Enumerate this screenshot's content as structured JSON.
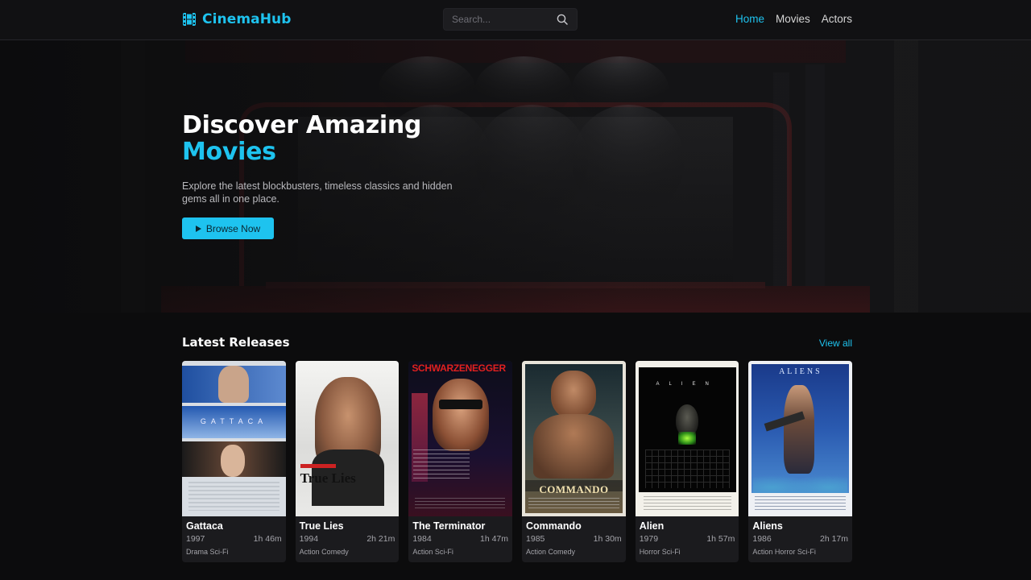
{
  "navbar": {
    "brand": "CinemaHub",
    "search_placeholder": "Search...",
    "links": [
      {
        "label": "Home",
        "active": true
      },
      {
        "label": "Movies",
        "active": false
      },
      {
        "label": "Actors",
        "active": false
      }
    ]
  },
  "hero": {
    "title_line1": "Discover Amazing",
    "title_line2": "Movies",
    "description": "Explore the latest blockbusters, timeless classics and hidden gems all in one place.",
    "button_label": "Browse Now"
  },
  "latest": {
    "title": "Latest Releases",
    "view_all": "View all",
    "movies": [
      {
        "title": "Gattaca",
        "year": "1997",
        "runtime": "1h 46m",
        "genres": "Drama Sci-Fi",
        "poster_text": "GATTACA"
      },
      {
        "title": "True Lies",
        "year": "1994",
        "runtime": "2h 21m",
        "genres": "Action Comedy",
        "poster_text": "True Lies"
      },
      {
        "title": "The Terminator",
        "year": "1984",
        "runtime": "1h 47m",
        "genres": "Action Sci-Fi",
        "poster_text": "SCHWARZENEGGER"
      },
      {
        "title": "Commando",
        "year": "1985",
        "runtime": "1h 30m",
        "genres": "Action Comedy",
        "poster_text": "COMMANDO"
      },
      {
        "title": "Alien",
        "year": "1979",
        "runtime": "1h 57m",
        "genres": "Horror Sci-Fi",
        "poster_text": "ALIEN"
      },
      {
        "title": "Aliens",
        "year": "1986",
        "runtime": "2h 17m",
        "genres": "Action Horror Sci-Fi",
        "poster_text": "ALIENS"
      }
    ]
  },
  "colors": {
    "accent": "#1ec3ef",
    "background": "#0c0c0d",
    "card": "#1b1b1e"
  }
}
